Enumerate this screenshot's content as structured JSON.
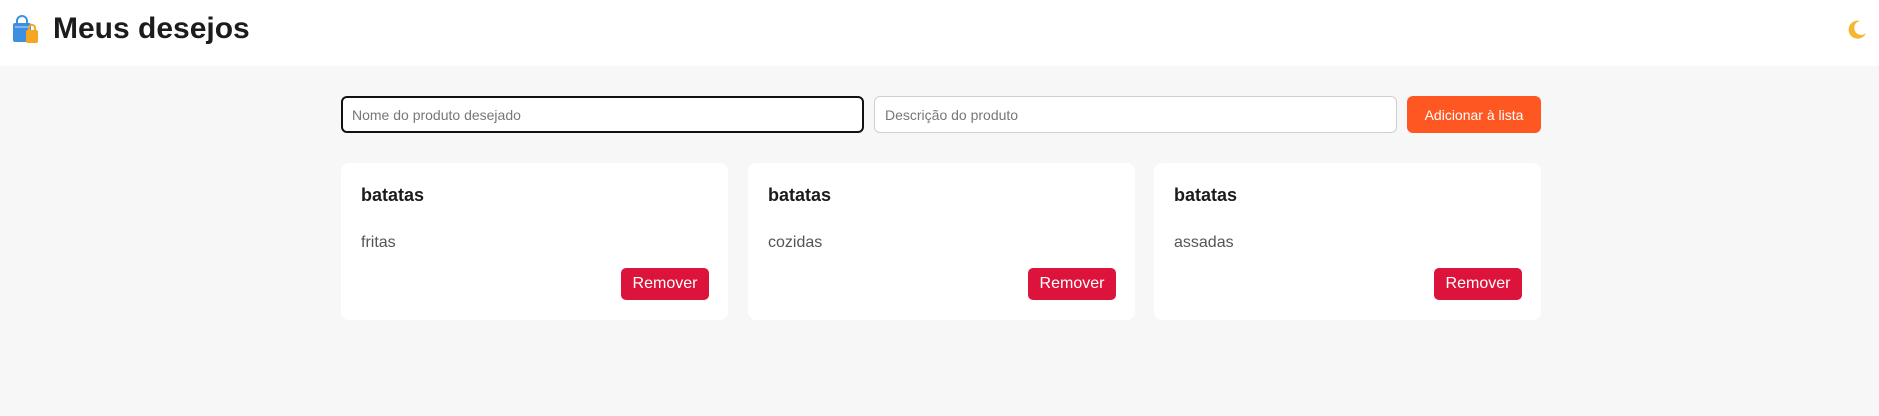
{
  "header": {
    "title": "Meus desejos",
    "logo_icon": "shopping-bags-icon",
    "theme_toggle_icon": "crescent-moon-icon"
  },
  "form": {
    "name_placeholder": "Nome do produto desejado",
    "description_placeholder": "Descrição do produto",
    "add_label": "Adicionar à lista"
  },
  "items": [
    {
      "title": "batatas",
      "description": "fritas",
      "remove_label": "Remover"
    },
    {
      "title": "batatas",
      "description": "cozidas",
      "remove_label": "Remover"
    },
    {
      "title": "batatas",
      "description": "assadas",
      "remove_label": "Remover"
    }
  ],
  "colors": {
    "accent_add": "#ff5722",
    "remove": "#dc143c",
    "background": "#f7f7f7"
  }
}
